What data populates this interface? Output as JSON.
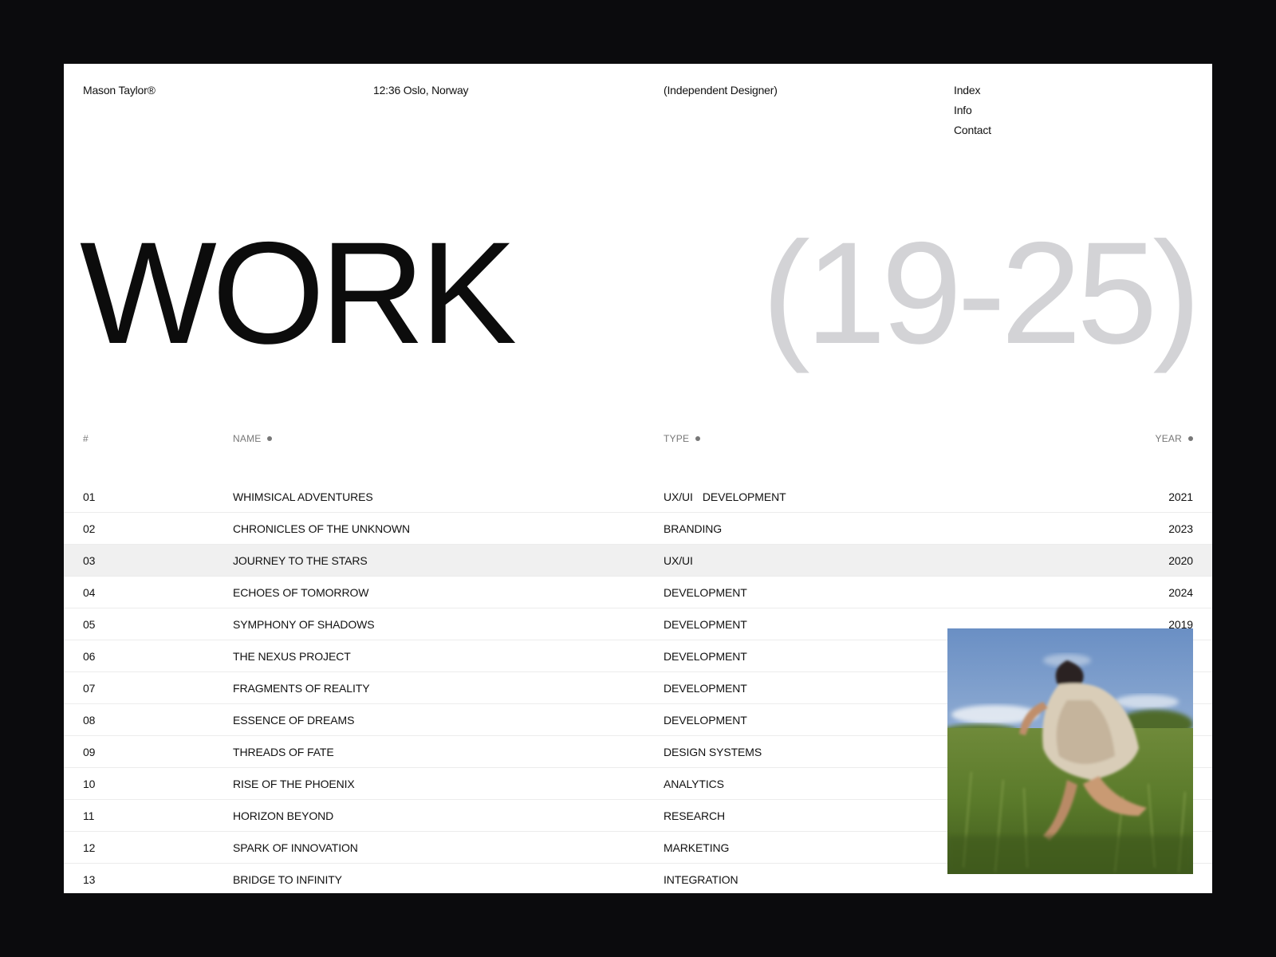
{
  "header": {
    "brand": "Mason Taylor®",
    "clock": "12:36 Oslo, Norway",
    "role": "(Independent Designer)",
    "nav": [
      {
        "label": "Index"
      },
      {
        "label": "Info"
      },
      {
        "label": "Contact"
      }
    ]
  },
  "hero": {
    "title": "WORK",
    "years": "(19-25)"
  },
  "table": {
    "headers": {
      "num": "#",
      "name": "NAME",
      "type": "TYPE",
      "year": "YEAR"
    },
    "highlighted_row": "03",
    "rows": [
      {
        "num": "01",
        "name": "WHIMSICAL ADVENTURES",
        "types": [
          "UX/UI",
          "DEVELOPMENT"
        ],
        "year": "2021"
      },
      {
        "num": "02",
        "name": "CHRONICLES OF THE UNKNOWN",
        "types": [
          "BRANDING"
        ],
        "year": "2023"
      },
      {
        "num": "03",
        "name": "JOURNEY TO THE STARS",
        "types": [
          "UX/UI"
        ],
        "year": "2020"
      },
      {
        "num": "04",
        "name": "ECHOES OF TOMORROW",
        "types": [
          "DEVELOPMENT"
        ],
        "year": "2024"
      },
      {
        "num": "05",
        "name": "SYMPHONY OF SHADOWS",
        "types": [
          "DEVELOPMENT"
        ],
        "year": "2019"
      },
      {
        "num": "06",
        "name": "THE NEXUS PROJECT",
        "types": [
          "DEVELOPMENT"
        ],
        "year": ""
      },
      {
        "num": "07",
        "name": "FRAGMENTS OF REALITY",
        "types": [
          "DEVELOPMENT"
        ],
        "year": ""
      },
      {
        "num": "08",
        "name": "ESSENCE OF DREAMS",
        "types": [
          "DEVELOPMENT"
        ],
        "year": ""
      },
      {
        "num": "09",
        "name": "THREADS OF FATE",
        "types": [
          "DESIGN SYSTEMS"
        ],
        "year": ""
      },
      {
        "num": "10",
        "name": "RISE OF THE PHOENIX",
        "types": [
          "ANALYTICS"
        ],
        "year": ""
      },
      {
        "num": "11",
        "name": "HORIZON BEYOND",
        "types": [
          "RESEARCH"
        ],
        "year": ""
      },
      {
        "num": "12",
        "name": "SPARK OF INNOVATION",
        "types": [
          "MARKETING"
        ],
        "year": ""
      },
      {
        "num": "13",
        "name": "BRIDGE TO INFINITY",
        "types": [
          "INTEGRATION"
        ],
        "year": ""
      }
    ]
  },
  "preview": {
    "icon": "photo-running-figure-in-field"
  },
  "colors": {
    "frame": "#0b0b0d",
    "page": "#ffffff",
    "text": "#111111",
    "muted": "#d3d3d6",
    "row_highlight": "#f0f0f0"
  }
}
